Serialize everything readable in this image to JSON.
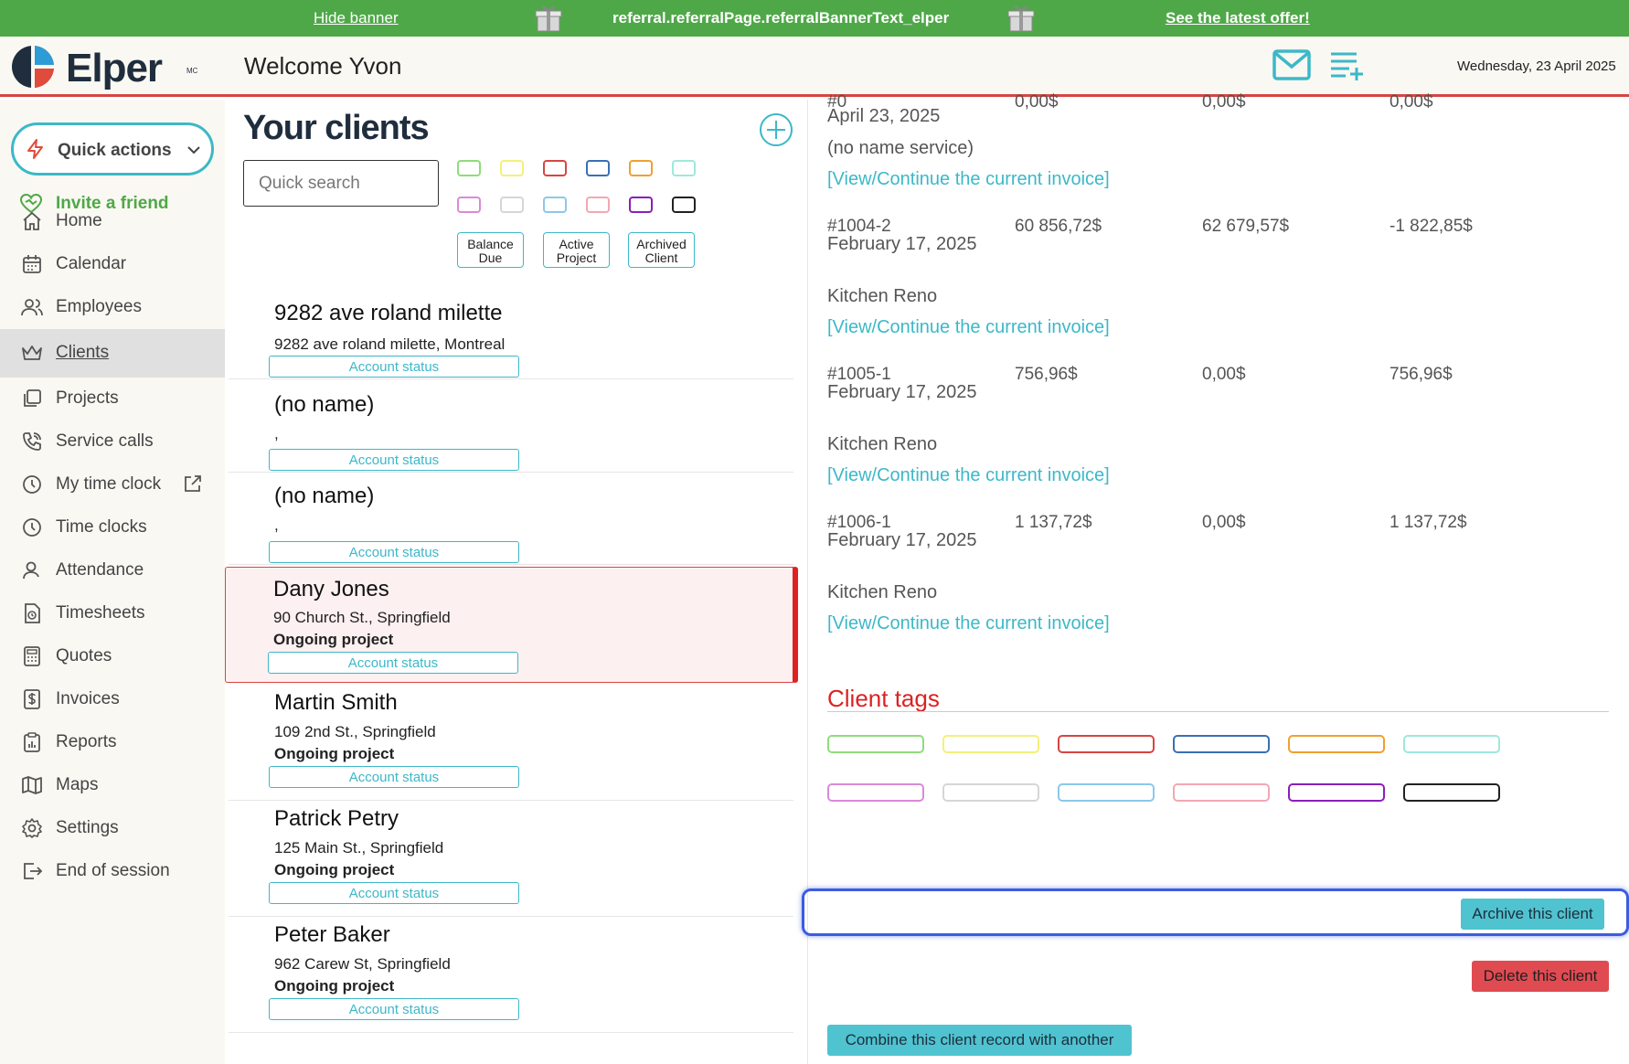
{
  "banner": {
    "hide_label": "Hide banner",
    "text": "referral.referralPage.referralBannerText_elper",
    "offer_label": "See the latest offer!"
  },
  "header": {
    "logo_text": "Elper",
    "logo_mark_suffix": "MC",
    "welcome": "Welcome Yvon",
    "date": "Wednesday, 23 April 2025"
  },
  "sidebar": {
    "quick_actions": "Quick actions",
    "invite": "Invite a friend",
    "items": [
      {
        "label": "Home",
        "icon": "home-icon"
      },
      {
        "label": "Calendar",
        "icon": "calendar-icon"
      },
      {
        "label": "Employees",
        "icon": "users-icon"
      },
      {
        "label": "Clients",
        "icon": "crown-icon"
      },
      {
        "label": "Projects",
        "icon": "projects-icon"
      },
      {
        "label": "Service calls",
        "icon": "phone-icon"
      },
      {
        "label": "My time clock",
        "icon": "clock-icon"
      },
      {
        "label": "Time clocks",
        "icon": "clock-icon"
      },
      {
        "label": "Attendance",
        "icon": "user-icon"
      },
      {
        "label": "Timesheets",
        "icon": "timesheet-icon"
      },
      {
        "label": "Quotes",
        "icon": "calculator-icon"
      },
      {
        "label": "Invoices",
        "icon": "invoice-icon"
      },
      {
        "label": "Reports",
        "icon": "report-icon"
      },
      {
        "label": "Maps",
        "icon": "map-icon"
      },
      {
        "label": "Settings",
        "icon": "gear-icon"
      },
      {
        "label": "End of session",
        "icon": "logout-icon"
      }
    ],
    "active": "Clients"
  },
  "clients_panel": {
    "title": "Your clients",
    "search_placeholder": "Quick search",
    "filters": [
      "Balance Due",
      "Active Project",
      "Archived Client"
    ],
    "swatch_colors": [
      "#8fdc7a",
      "#f4f07a",
      "#d64541",
      "#3a6fb5",
      "#f0a030",
      "#9ee8dc",
      "#d98ad8",
      "#d6d6d6",
      "#8cc8e8",
      "#f2a8b4",
      "#8a1fb8",
      "#222222"
    ],
    "account_status_label": "Account status",
    "clients": [
      {
        "name": "9282 ave roland milette",
        "address": "9282 ave roland milette, Montreal",
        "status": ""
      },
      {
        "name": "(no name)",
        "address": ",",
        "status": ""
      },
      {
        "name": "(no name)",
        "address": ",",
        "status": ""
      },
      {
        "name": "Dany Jones",
        "address": "90 Church St., Springfield",
        "status": "Ongoing project"
      },
      {
        "name": "Martin Smith",
        "address": "109 2nd St., Springfield",
        "status": "Ongoing project"
      },
      {
        "name": "Patrick Petry",
        "address": "125 Main St., Springfield",
        "status": "Ongoing project"
      },
      {
        "name": "Peter Baker",
        "address": "962 Carew St, Springfield",
        "status": "Ongoing project"
      }
    ]
  },
  "detail": {
    "invoices": [
      {
        "number": "#0",
        "date": "April 23, 2025",
        "total": "0,00$",
        "paid": "0,00$",
        "balance": "0,00$",
        "service": "(no name service)",
        "link": "[View/Continue the current invoice]"
      },
      {
        "number": "#1004-2",
        "date": "February 17, 2025",
        "total": "60 856,72$",
        "paid": "62 679,57$",
        "balance": "-1 822,85$",
        "service": "Kitchen Reno",
        "link": "[View/Continue the current invoice]"
      },
      {
        "number": "#1005-1",
        "date": "February 17, 2025",
        "total": "756,96$",
        "paid": "0,00$",
        "balance": "756,96$",
        "service": "Kitchen Reno",
        "link": "[View/Continue the current invoice]"
      },
      {
        "number": "#1006-1",
        "date": "February 17, 2025",
        "total": "1 137,72$",
        "paid": "0,00$",
        "balance": "1 137,72$",
        "service": "Kitchen Reno",
        "link": "[View/Continue the current invoice]"
      }
    ],
    "tags_title": "Client tags",
    "tag_colors": [
      "#8fdc7a",
      "#f4f07a",
      "#d64541",
      "#3a6fb5",
      "#f0a030",
      "#9ee8dc",
      "#d98ad8",
      "#d6d6d6",
      "#8cc8e8",
      "#f2a8b4",
      "#8a1fb8",
      "#222222"
    ],
    "archive_label": "Archive this client",
    "delete_label": "Delete this client",
    "combine_label": "Combine this client record with another"
  }
}
